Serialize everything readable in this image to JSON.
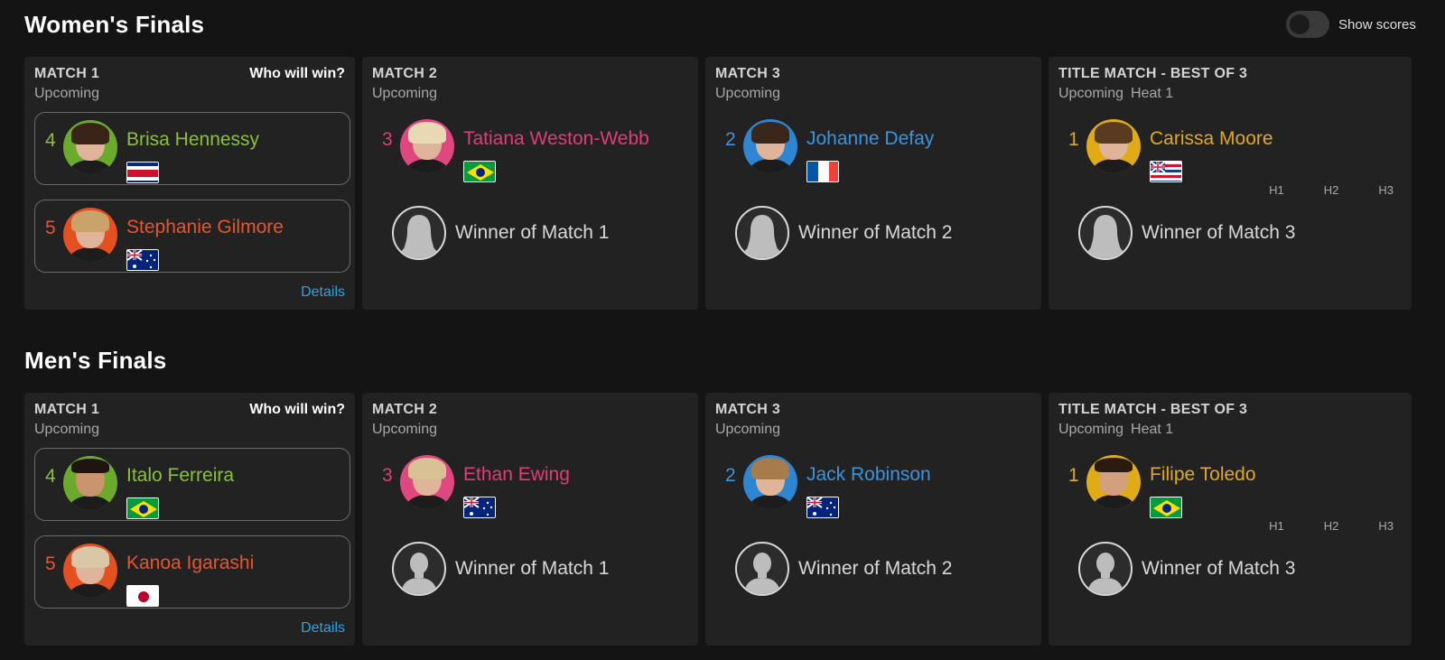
{
  "toggle": {
    "label": "Show scores",
    "on": false
  },
  "sections": [
    {
      "title": "Women's Finals",
      "matches": [
        {
          "head": "MATCH 1",
          "status": "Upcoming",
          "who_win": "Who will win?",
          "details": "Details",
          "athletes": [
            {
              "seed": "4",
              "name": "Brisa Hennessy",
              "flag": "costa-rica-flag",
              "color": "#8bc03a"
            },
            {
              "seed": "5",
              "name": "Stephanie Gilmore",
              "flag": "australia-flag",
              "color": "#e8552d"
            }
          ]
        },
        {
          "head": "MATCH 2",
          "status": "Upcoming",
          "athlete": {
            "seed": "3",
            "name": "Tatiana Weston-Webb",
            "flag": "brazil-flag",
            "color": "#e33b7a"
          },
          "placeholder": "Winner of Match 1"
        },
        {
          "head": "MATCH 3",
          "status": "Upcoming",
          "athlete": {
            "seed": "2",
            "name": "Johanne Defay",
            "flag": "france-flag",
            "color": "#3b94de"
          },
          "placeholder": "Winner of Match 2"
        },
        {
          "head": "TITLE MATCH - BEST OF 3",
          "status": "Upcoming",
          "heat": "Heat 1",
          "athlete": {
            "seed": "1",
            "name": "Carissa Moore",
            "flag": "hawaii-flag",
            "color": "#e2a91c"
          },
          "heat_labels": [
            "H1",
            "H2",
            "H3"
          ],
          "placeholder": "Winner of Match 3"
        }
      ]
    },
    {
      "title": "Men's Finals",
      "matches": [
        {
          "head": "MATCH 1",
          "status": "Upcoming",
          "who_win": "Who will win?",
          "details": "Details",
          "athletes": [
            {
              "seed": "4",
              "name": "Italo Ferreira",
              "flag": "brazil-flag",
              "color": "#8bc03a"
            },
            {
              "seed": "5",
              "name": "Kanoa Igarashi",
              "flag": "japan-flag",
              "color": "#e8552d"
            }
          ]
        },
        {
          "head": "MATCH 2",
          "status": "Upcoming",
          "athlete": {
            "seed": "3",
            "name": "Ethan Ewing",
            "flag": "australia-flag",
            "color": "#e33b7a"
          },
          "placeholder": "Winner of Match 1"
        },
        {
          "head": "MATCH 3",
          "status": "Upcoming",
          "athlete": {
            "seed": "2",
            "name": "Jack Robinson",
            "flag": "australia-flag",
            "color": "#3b94de"
          },
          "placeholder": "Winner of Match 2"
        },
        {
          "head": "TITLE MATCH - BEST OF 3",
          "status": "Upcoming",
          "heat": "Heat 1",
          "athlete": {
            "seed": "1",
            "name": "Filipe Toledo",
            "flag": "brazil-flag",
            "color": "#e2a91c"
          },
          "heat_labels": [
            "H1",
            "H2",
            "H3"
          ],
          "placeholder": "Winner of Match 3"
        }
      ]
    }
  ]
}
